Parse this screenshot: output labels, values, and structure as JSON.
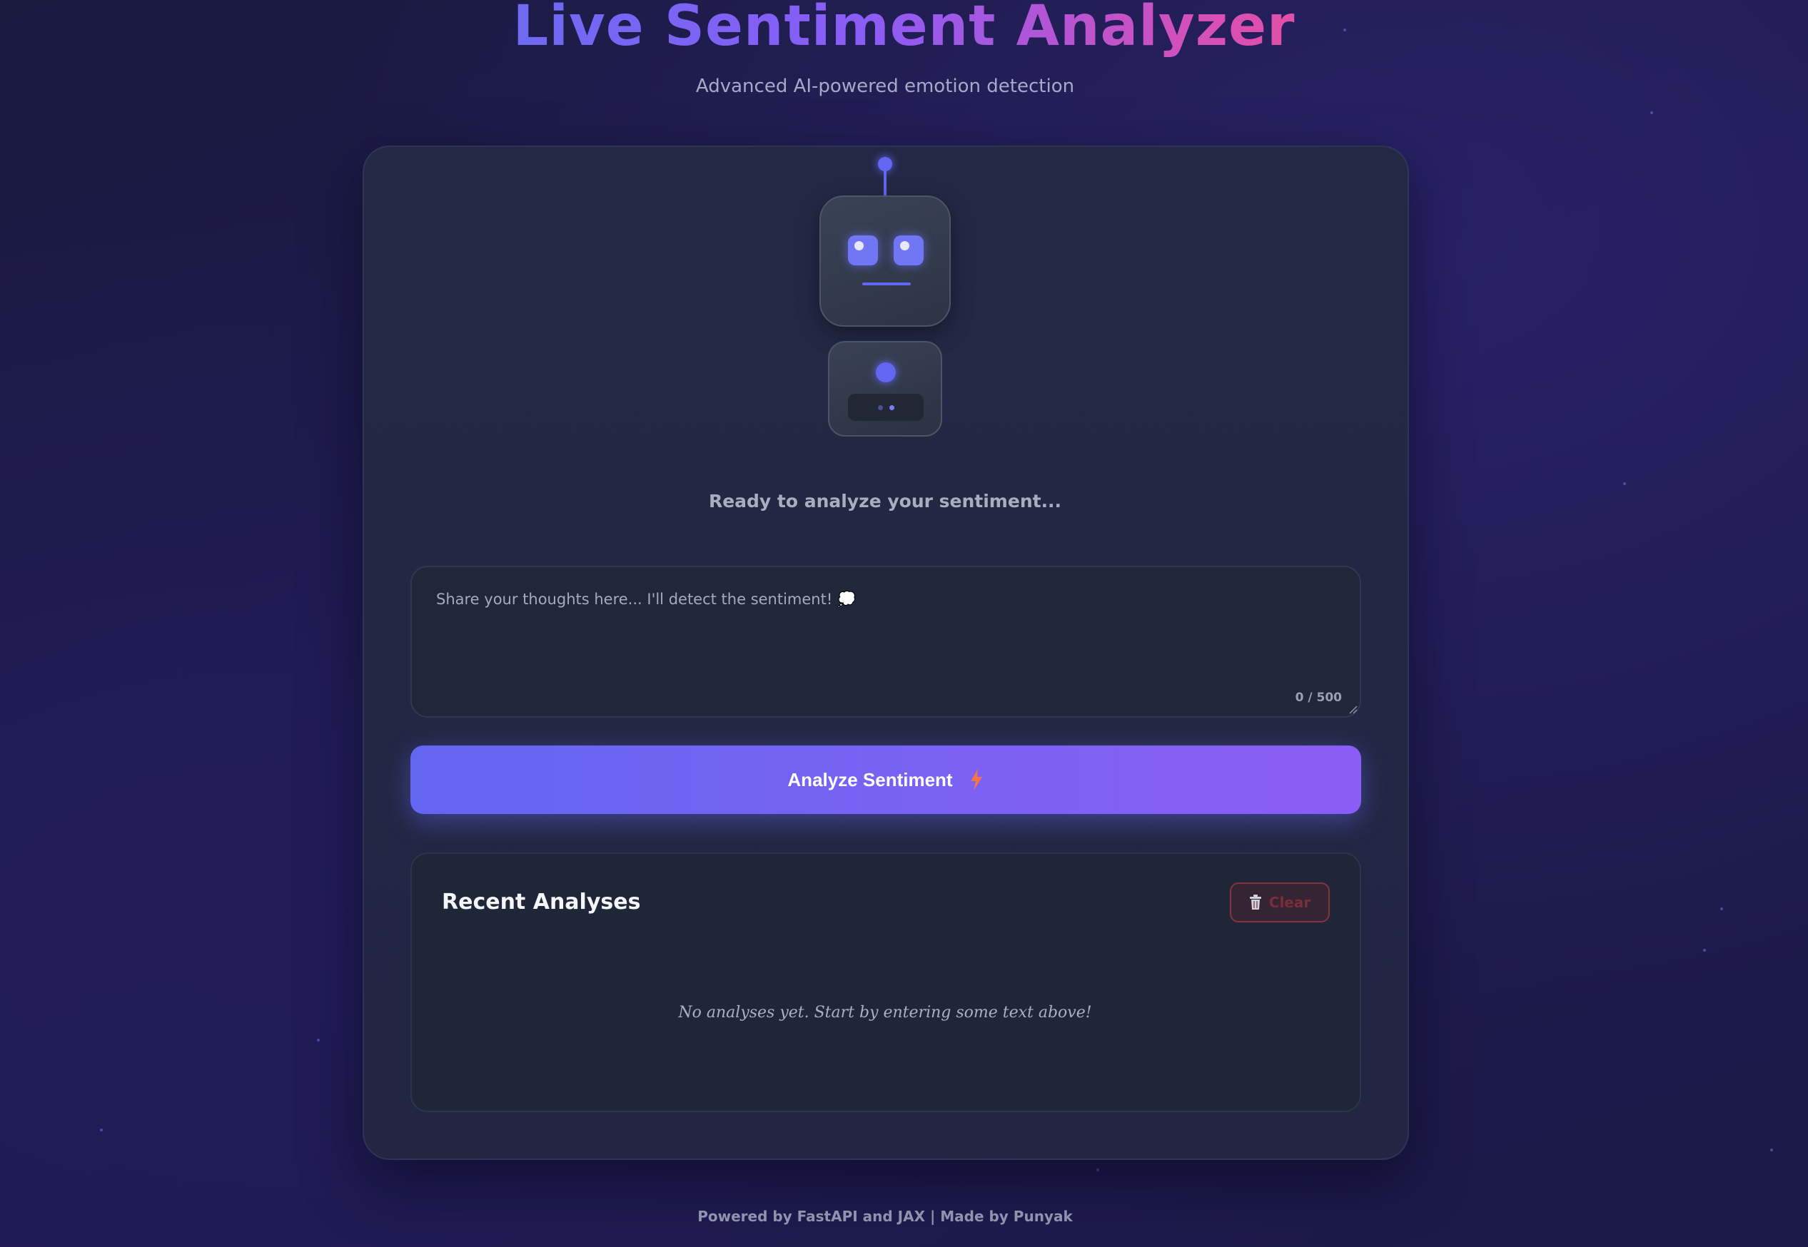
{
  "header": {
    "title": "Live Sentiment Analyzer",
    "subtitle": "Advanced AI-powered emotion detection"
  },
  "robot": {
    "state": "neutral",
    "accent_color": "#6366f1"
  },
  "status": {
    "text": "Ready to analyze your sentiment..."
  },
  "input": {
    "placeholder": "Share your thoughts here... I'll detect the sentiment! 💭",
    "value": "",
    "char_count": "0 / 500"
  },
  "analyze_button": {
    "label": "Analyze Sentiment",
    "icon": "lightning-bolt-icon"
  },
  "history": {
    "title": "Recent Analyses",
    "clear_label": "Clear",
    "clear_icon": "trash-icon",
    "empty_message": "No analyses yet. Start by entering some text above!"
  },
  "footer": {
    "text": "Powered by FastAPI and JAX | Made by Punyak"
  },
  "colors": {
    "primary": "#6366f1",
    "secondary": "#8b5cf6",
    "title_pink": "#e14fa7",
    "danger": "#ef4444"
  }
}
